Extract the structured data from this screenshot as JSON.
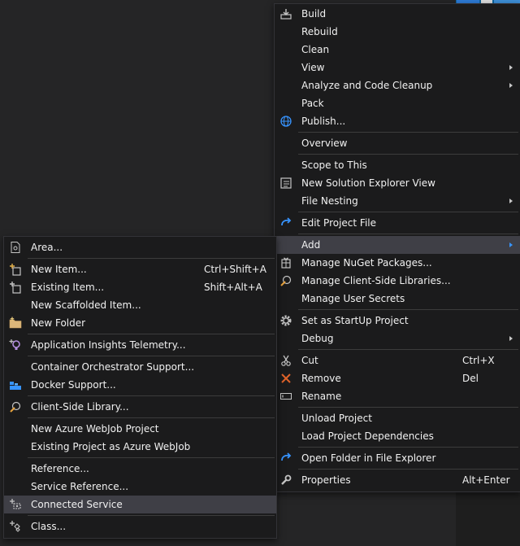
{
  "main_menu": {
    "items": [
      {
        "label": "Build"
      },
      {
        "label": "Rebuild"
      },
      {
        "label": "Clean"
      },
      {
        "label": "View"
      },
      {
        "label": "Analyze and Code Cleanup"
      },
      {
        "label": "Pack"
      },
      {
        "label": "Publish..."
      },
      {
        "label": "Overview"
      },
      {
        "label": "Scope to This"
      },
      {
        "label": "New Solution Explorer View"
      },
      {
        "label": "File Nesting"
      },
      {
        "label": "Edit Project File"
      },
      {
        "label": "Add"
      },
      {
        "label": "Manage NuGet Packages..."
      },
      {
        "label": "Manage Client-Side Libraries..."
      },
      {
        "label": "Manage User Secrets"
      },
      {
        "label": "Set as StartUp Project"
      },
      {
        "label": "Debug"
      },
      {
        "label": "Cut",
        "shortcut": "Ctrl+X"
      },
      {
        "label": "Remove",
        "shortcut": "Del"
      },
      {
        "label": "Rename"
      },
      {
        "label": "Unload Project"
      },
      {
        "label": "Load Project Dependencies"
      },
      {
        "label": "Open Folder in File Explorer"
      },
      {
        "label": "Properties",
        "shortcut": "Alt+Enter"
      }
    ]
  },
  "add_menu": {
    "items": [
      {
        "label": "Area..."
      },
      {
        "label": "New Item...",
        "shortcut": "Ctrl+Shift+A"
      },
      {
        "label": "Existing Item...",
        "shortcut": "Shift+Alt+A"
      },
      {
        "label": "New Scaffolded Item..."
      },
      {
        "label": "New Folder"
      },
      {
        "label": "Application Insights Telemetry..."
      },
      {
        "label": "Container Orchestrator Support..."
      },
      {
        "label": "Docker Support..."
      },
      {
        "label": "Client-Side Library..."
      },
      {
        "label": "New Azure WebJob Project"
      },
      {
        "label": "Existing Project as Azure WebJob"
      },
      {
        "label": "Reference..."
      },
      {
        "label": "Service Reference..."
      },
      {
        "label": "Connected Service"
      },
      {
        "label": "Class..."
      }
    ]
  },
  "colors": {
    "menu_bg": "#1b1b1c",
    "highlight": "#3f3f46",
    "accent": "#3794ff"
  }
}
